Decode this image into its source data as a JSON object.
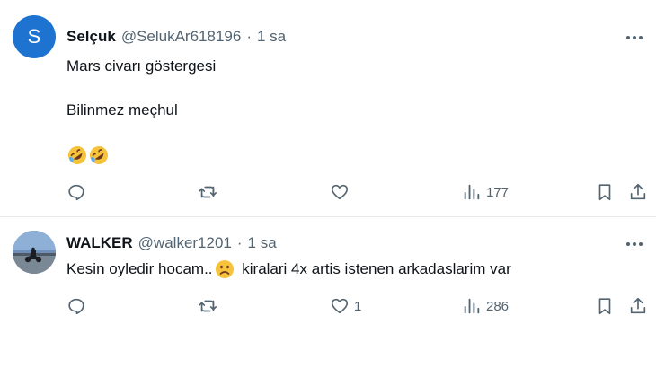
{
  "tweets": [
    {
      "avatar_letter": "S",
      "name": "Selçuk",
      "handle": "@SelukAr618196",
      "time": "1 sa",
      "lines": [
        "Mars civarı göstergesi",
        "Bilinmez meçhul"
      ],
      "emoji": [
        "rolling-on-floor-laughing",
        "rolling-on-floor-laughing"
      ],
      "replies": "",
      "retweets": "",
      "likes": "",
      "views": "177"
    },
    {
      "avatar": "motorcycle-silhouette",
      "name": "WALKER",
      "handle": "@walker1201",
      "time": "1 sa",
      "text_before": "Kesin oyledir hocam..",
      "emoji": "slightly-frowning-face",
      "text_after": " kiralari 4x artis istenen arkadaslarim var",
      "replies": "",
      "retweets": "",
      "likes": "1",
      "views": "286"
    }
  ],
  "separator": "·",
  "colors": {
    "text": "#0f1419",
    "muted": "#536471",
    "border": "#e7e9ea",
    "avatar_blue": "#1d73cf"
  }
}
